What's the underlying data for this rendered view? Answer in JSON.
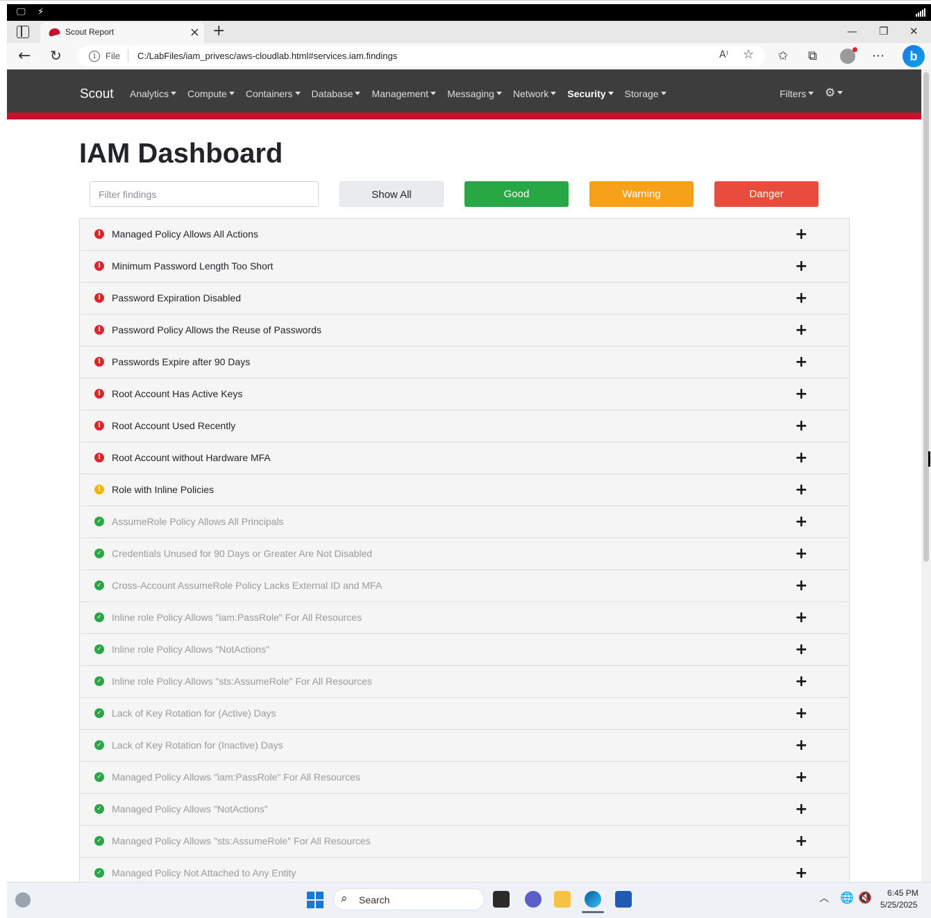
{
  "browser": {
    "tab_title": "Scout Report",
    "url_scheme": "File",
    "url": "C:/LabFiles/iam_privesc/aws-cloudlab.html#services.iam.findings"
  },
  "navbar": {
    "brand": "Scout",
    "menus": [
      {
        "label": "Analytics",
        "active": false
      },
      {
        "label": "Compute",
        "active": false
      },
      {
        "label": "Containers",
        "active": false
      },
      {
        "label": "Database",
        "active": false
      },
      {
        "label": "Management",
        "active": false
      },
      {
        "label": "Messaging",
        "active": false
      },
      {
        "label": "Network",
        "active": false
      },
      {
        "label": "Security",
        "active": true
      },
      {
        "label": "Storage",
        "active": false
      }
    ],
    "filters_label": "Filters",
    "accent_color": "#c8102e"
  },
  "dashboard": {
    "title": "IAM Dashboard",
    "filter_placeholder": "Filter findings",
    "buttons": {
      "show_all": "Show All",
      "good": "Good",
      "warning": "Warning",
      "danger": "Danger"
    },
    "colors": {
      "good": "#28a745",
      "warning": "#f7a11a",
      "danger": "#e74c3c"
    }
  },
  "findings": [
    {
      "title": "Managed Policy Allows All Actions",
      "level": "danger"
    },
    {
      "title": "Minimum Password Length Too Short",
      "level": "danger"
    },
    {
      "title": "Password Expiration Disabled",
      "level": "danger"
    },
    {
      "title": "Password Policy Allows the Reuse of Passwords",
      "level": "danger"
    },
    {
      "title": "Passwords Expire after 90 Days",
      "level": "danger"
    },
    {
      "title": "Root Account Has Active Keys",
      "level": "danger"
    },
    {
      "title": "Root Account Used Recently",
      "level": "danger"
    },
    {
      "title": "Root Account without Hardware MFA",
      "level": "danger"
    },
    {
      "title": "Role with Inline Policies",
      "level": "warning"
    },
    {
      "title": "AssumeRole Policy Allows All Principals",
      "level": "good"
    },
    {
      "title": "Credentials Unused for 90 Days or Greater Are Not Disabled",
      "level": "good"
    },
    {
      "title": "Cross-Account AssumeRole Policy Lacks External ID and MFA",
      "level": "good"
    },
    {
      "title": "Inline role Policy Allows \"iam:PassRole\" For All Resources",
      "level": "good"
    },
    {
      "title": "Inline role Policy Allows \"NotActions\"",
      "level": "good"
    },
    {
      "title": "Inline role Policy Allows \"sts:AssumeRole\" For All Resources",
      "level": "good"
    },
    {
      "title": "Lack of Key Rotation for (Active) Days",
      "level": "good"
    },
    {
      "title": "Lack of Key Rotation for (Inactive) Days",
      "level": "good"
    },
    {
      "title": "Managed Policy Allows \"iam:PassRole\" For All Resources",
      "level": "good"
    },
    {
      "title": "Managed Policy Allows \"NotActions\"",
      "level": "good"
    },
    {
      "title": "Managed Policy Allows \"sts:AssumeRole\" For All Resources",
      "level": "good"
    },
    {
      "title": "Managed Policy Not Attached to Any Entity",
      "level": "good"
    }
  ],
  "taskbar": {
    "search_label": "Search",
    "time": "6:45 PM",
    "date": "5/25/2025"
  }
}
